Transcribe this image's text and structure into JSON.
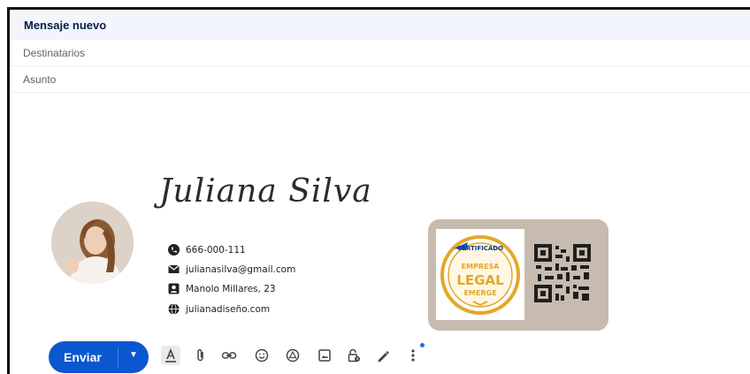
{
  "compose": {
    "title": "Mensaje nuevo",
    "recipients_placeholder": "Destinatarios",
    "subject_placeholder": "Asunto"
  },
  "signature": {
    "name": "Juliana Silva",
    "phone": "666-000-111",
    "email": "julianasilva@gmail.com",
    "address": "Manolo Millares, 23",
    "website": "julianadiseño.com",
    "badge": {
      "line1": "CERTIFICADO",
      "line2": "EMPRESA",
      "line3": "LEGAL",
      "line4": "EMERGE"
    }
  },
  "toolbar": {
    "send_label": "Enviar",
    "icons": [
      "format-text-icon",
      "attach-icon",
      "link-icon",
      "emoji-icon",
      "drive-icon",
      "image-icon",
      "confidential-icon",
      "signature-icon",
      "more-options-icon"
    ]
  },
  "colors": {
    "accent": "#0b57d0",
    "header_bg": "#f2f6fc",
    "card_bg": "#c7bbaf",
    "badge_gold": "#e3a82b"
  }
}
